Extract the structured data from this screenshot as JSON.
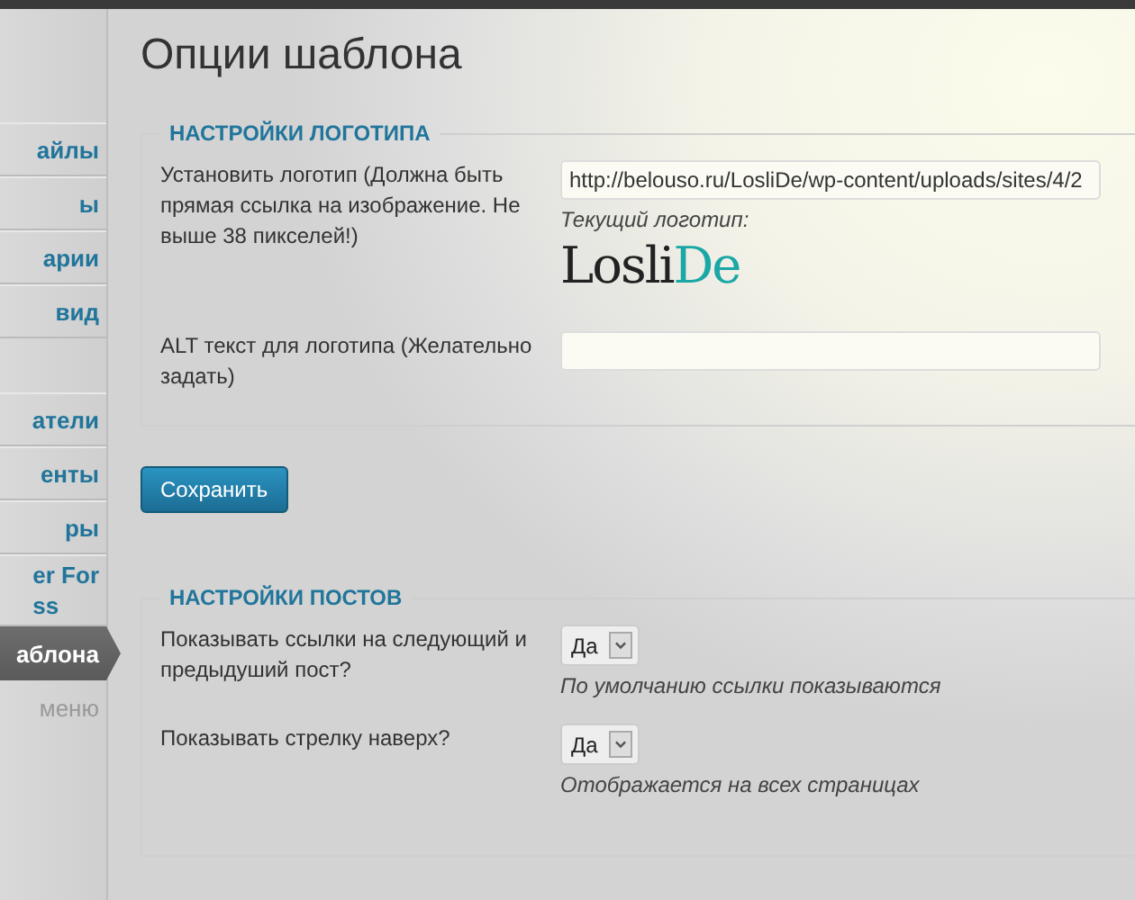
{
  "sidebar": {
    "items": [
      {
        "label": "айлы",
        "kind": "item",
        "selected": false
      },
      {
        "label": "ы",
        "kind": "item",
        "selected": false
      },
      {
        "label": "арии",
        "kind": "item",
        "selected": false
      },
      {
        "label": "вид",
        "kind": "item",
        "selected": false
      },
      {
        "kind": "blank"
      },
      {
        "label": "атели",
        "kind": "item",
        "selected": false
      },
      {
        "label": "енты",
        "kind": "item",
        "selected": false
      },
      {
        "label": "ры",
        "kind": "item",
        "selected": false
      },
      {
        "label": "er For\nss",
        "kind": "item",
        "selected": false
      },
      {
        "label": "аблона",
        "kind": "item",
        "selected": true
      },
      {
        "label": "меню",
        "kind": "subitem",
        "selected": false
      }
    ]
  },
  "page": {
    "title": "Опции шаблона"
  },
  "logo_section": {
    "legend": "НАСТРОЙКИ ЛОГОТИПА",
    "logo_field": {
      "label": "Установить логотип (Должна быть прямая ссылка на изображение. Не выше 38 пикселей!)",
      "value": "http://belouso.ru/LosliDe/wp-content/uploads/sites/4/2",
      "note": "Текущий логотип:",
      "logo": {
        "text": "Losli",
        "accent": "De"
      }
    },
    "alt_field": {
      "label": "ALT текст для логотипа (Желательно задать)"
    }
  },
  "save_button": "Сохранить",
  "posts_section": {
    "legend": "НАСТРОЙКИ ПОСТОВ",
    "options": [
      {
        "label": "Показывать ссылки на следующий и предыдуший пост?",
        "value": "Да",
        "note": "По умолчанию ссылки показываются"
      },
      {
        "label": "Показывать стрелку наверх?",
        "value": "Да",
        "note": "Отображается на всех страницах"
      }
    ]
  }
}
